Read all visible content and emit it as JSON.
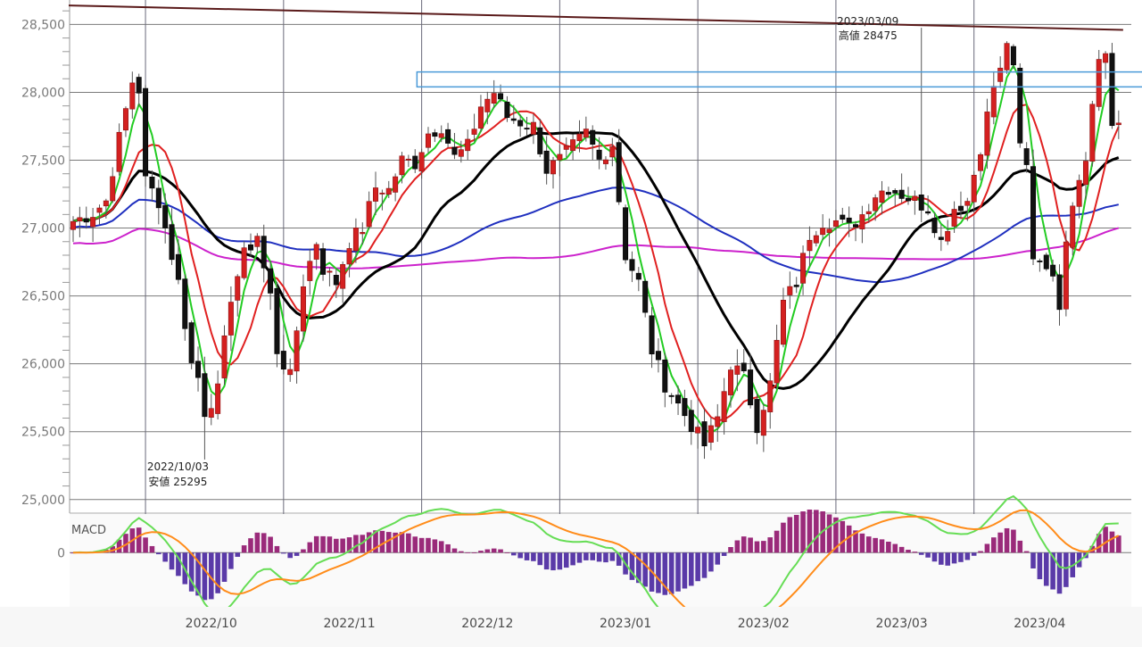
{
  "chart_data": {
    "type": "candlestick",
    "title": "",
    "price_axis": {
      "min": 24900,
      "max": 28680,
      "ticks": [
        "25,000",
        "25,500",
        "26,000",
        "26,500",
        "27,000",
        "27,500",
        "28,000",
        "28,500"
      ],
      "tick_values": [
        25000,
        25500,
        26000,
        26500,
        27000,
        27500,
        28000,
        28500
      ]
    },
    "time_axis": {
      "labels": [
        "2022/10",
        "2022/11",
        "2022/12",
        "2023/01",
        "2023/02",
        "2023/03",
        "2023/04"
      ],
      "label_index": [
        21,
        42,
        63,
        84,
        105,
        126,
        147
      ],
      "month_lines": [
        11,
        32,
        53,
        74,
        95,
        116,
        137
      ],
      "count": 160
    },
    "annotations": {
      "high_date": "2023/03/09",
      "high_text": "高値 28475",
      "high_index": 129,
      "high_value": 28475,
      "low_date": "2022/10/03",
      "low_text": "安値 25295",
      "low_index": 20,
      "low_value": 25295
    },
    "resistance_box": {
      "start_index": 55,
      "end_index": 159,
      "low": 28040,
      "high": 28150
    },
    "trend_line": {
      "start_index": 0,
      "start_value": 28640,
      "end_index": 159,
      "end_value": 28460
    },
    "series_colors": {
      "ma_short": "#22cc22",
      "ma_mid": "#e02020",
      "ma_long": "#000000",
      "ma_75": "#1f2fbf",
      "ma_200": "#cc22cc",
      "bull": "#d42020",
      "bear": "#111111",
      "box": "#4a9ad8",
      "trend": "#5a1a1a",
      "macd_pos": "#9a2a7a",
      "macd_neg": "#5a3aa8",
      "macd_line": "#66dd55",
      "signal_line": "#ff8c1a"
    },
    "macd": {
      "label": "MACD",
      "zero_label": "0",
      "min": -330,
      "max": 230
    },
    "close_anchors": [
      [
        0,
        27050
      ],
      [
        3,
        27110
      ],
      [
        5,
        27200
      ],
      [
        7,
        27660
      ],
      [
        9,
        28080
      ],
      [
        10,
        28020
      ],
      [
        11,
        27350
      ],
      [
        13,
        27200
      ],
      [
        16,
        26600
      ],
      [
        18,
        26000
      ],
      [
        19,
        25900
      ],
      [
        20,
        25650
      ],
      [
        22,
        25800
      ],
      [
        24,
        26500
      ],
      [
        26,
        26800
      ],
      [
        28,
        26950
      ],
      [
        29,
        26700
      ],
      [
        30,
        26500
      ],
      [
        31,
        26100
      ],
      [
        33,
        25900
      ],
      [
        35,
        26600
      ],
      [
        37,
        26900
      ],
      [
        38,
        26700
      ],
      [
        40,
        26600
      ],
      [
        42,
        26900
      ],
      [
        44,
        27000
      ],
      [
        46,
        27300
      ],
      [
        48,
        27280
      ],
      [
        50,
        27500
      ],
      [
        52,
        27480
      ],
      [
        54,
        27700
      ],
      [
        56,
        27750
      ],
      [
        58,
        27520
      ],
      [
        60,
        27600
      ],
      [
        62,
        27900
      ],
      [
        64,
        28000
      ],
      [
        66,
        27820
      ],
      [
        68,
        27780
      ],
      [
        70,
        27750
      ],
      [
        72,
        27430
      ],
      [
        74,
        27500
      ],
      [
        76,
        27600
      ],
      [
        78,
        27700
      ],
      [
        80,
        27500
      ],
      [
        82,
        27620
      ],
      [
        84,
        26800
      ],
      [
        86,
        26600
      ],
      [
        88,
        26100
      ],
      [
        90,
        25850
      ],
      [
        92,
        25700
      ],
      [
        94,
        25550
      ],
      [
        96,
        25400
      ],
      [
        98,
        25600
      ],
      [
        100,
        26000
      ],
      [
        102,
        25900
      ],
      [
        104,
        25550
      ],
      [
        106,
        25850
      ],
      [
        108,
        26450
      ],
      [
        110,
        26600
      ],
      [
        112,
        26950
      ],
      [
        114,
        27050
      ],
      [
        116,
        27050
      ],
      [
        118,
        27000
      ],
      [
        120,
        27100
      ],
      [
        122,
        27250
      ],
      [
        124,
        27300
      ],
      [
        126,
        27250
      ],
      [
        128,
        27200
      ],
      [
        130,
        27150
      ],
      [
        132,
        26900
      ],
      [
        134,
        27150
      ],
      [
        136,
        27200
      ],
      [
        138,
        27600
      ],
      [
        140,
        28050
      ],
      [
        141,
        28150
      ],
      [
        142,
        28380
      ],
      [
        143,
        28150
      ],
      [
        144,
        27600
      ],
      [
        145,
        27450
      ],
      [
        146,
        26800
      ],
      [
        148,
        26750
      ],
      [
        150,
        26450
      ],
      [
        151,
        26950
      ],
      [
        152,
        27200
      ],
      [
        154,
        27550
      ],
      [
        156,
        28250
      ],
      [
        157,
        28300
      ],
      [
        158,
        27750
      ],
      [
        160,
        27700
      ],
      [
        162,
        28050
      ]
    ]
  }
}
